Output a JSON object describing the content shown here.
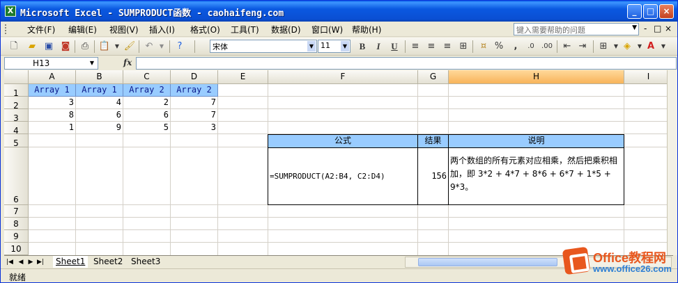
{
  "window": {
    "title": "Microsoft Excel - SUMPRODUCT函数 - caohaifeng.com",
    "min_label": "_",
    "max_label": "□",
    "close_label": "×"
  },
  "menu": {
    "items": [
      "文件(F)",
      "编辑(E)",
      "视图(V)",
      "插入(I)",
      "格式(O)",
      "工具(T)",
      "数据(D)",
      "窗口(W)",
      "帮助(H)"
    ],
    "help_placeholder": "键入需要帮助的问题",
    "mdi_controls": [
      "-",
      "□",
      "×"
    ]
  },
  "toolbar": {
    "font_name": "宋体",
    "font_size": "11",
    "bold": "B",
    "italic": "I",
    "underline": "U",
    "percent": "%",
    "comma": ","
  },
  "formula_bar": {
    "name_box": "H13",
    "fx_label": "fx",
    "formula": ""
  },
  "grid": {
    "columns": [
      "A",
      "B",
      "C",
      "D",
      "E",
      "F",
      "G",
      "H",
      "I"
    ],
    "active_column": "H",
    "rows": [
      "1",
      "2",
      "3",
      "4",
      "5",
      "6",
      "7",
      "8",
      "9",
      "10"
    ],
    "table_headers": [
      "Array 1",
      "Array 1",
      "Array 2",
      "Array 2"
    ],
    "table_values": [
      [
        "3",
        "4",
        "2",
        "7"
      ],
      [
        "8",
        "6",
        "6",
        "7"
      ],
      [
        "1",
        "9",
        "5",
        "3"
      ]
    ],
    "formula_table": {
      "headers": [
        "公式",
        "结果",
        "说明"
      ],
      "formula": "=SUMPRODUCT(A2:B4, C2:D4)",
      "result": "156",
      "explanation": "两个数组的所有元素对应相乘，然后把乘积相加，即 3*2 + 4*7 + 8*6 + 6*7 + 1*5 + 9*3。"
    }
  },
  "sheets": {
    "tabs": [
      "Sheet1",
      "Sheet2",
      "Sheet3"
    ],
    "active": "Sheet1"
  },
  "status": {
    "text": "就绪"
  },
  "watermark": {
    "title": "Office教程网",
    "url": "www.office26.com"
  },
  "colors": {
    "title_bar": "#0a58e0",
    "header_fill": "#99ccff",
    "active_column": "#f8b45a",
    "watermark_orange": "#e8571e",
    "watermark_blue": "#2e7fd4"
  }
}
